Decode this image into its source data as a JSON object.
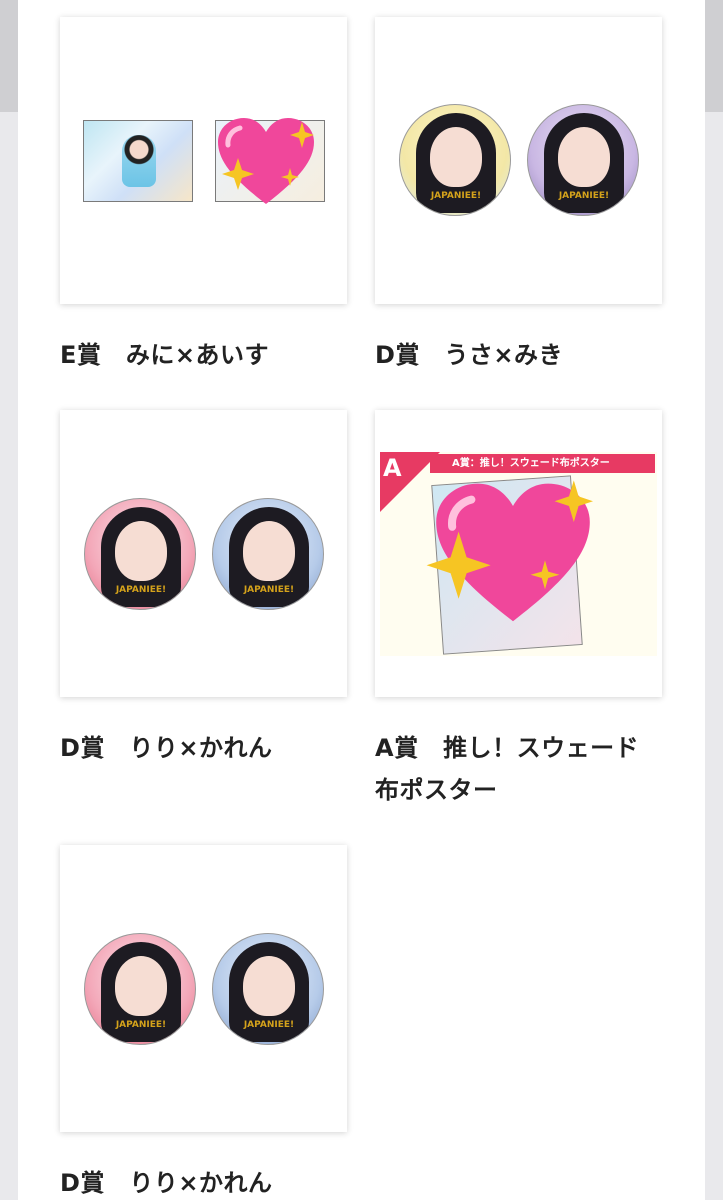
{
  "cards": [
    {
      "title": "E賞　みに×あいす"
    },
    {
      "title": "D賞　うさ×みき"
    },
    {
      "title": "D賞　りり×かれん"
    },
    {
      "title": "A賞　推し！スウェード布ポスター"
    },
    {
      "title": "D賞　りり×かれん"
    }
  ],
  "poster": {
    "corner_label": "A",
    "banner_text": "A賞：推し！スウェード布ポスター"
  },
  "badge_logo": "JAPANIEE!",
  "colors": {
    "accent": "#e73a63",
    "heart": "#f0479b",
    "sparkle": "#f6c523"
  },
  "icons": [
    "sparkling-heart-icon"
  ]
}
